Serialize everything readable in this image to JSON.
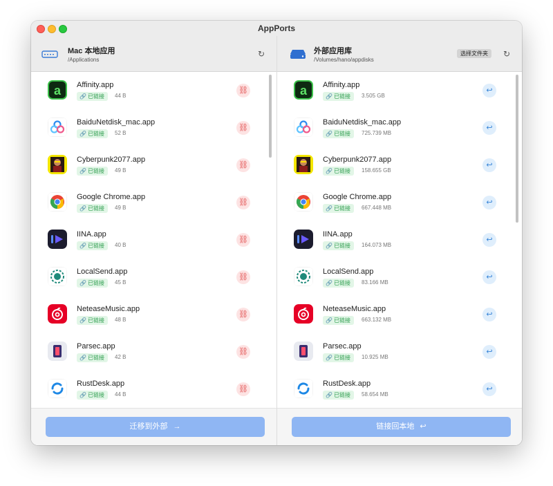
{
  "window": {
    "title": "AppPorts"
  },
  "left": {
    "title": "Mac 本地应用",
    "path": "/Applications",
    "refresh_icon": "refresh-icon",
    "action_icon": "unlink-icon",
    "footer_button": "迁移到外部",
    "footer_arrow": "→",
    "apps": [
      {
        "name": "Affinity.app",
        "status": "已链接",
        "size": "44 B",
        "icon": "affinity"
      },
      {
        "name": "BaiduNetdisk_mac.app",
        "status": "已链接",
        "size": "52 B",
        "icon": "baidu"
      },
      {
        "name": "Cyberpunk2077.app",
        "status": "已链接",
        "size": "49 B",
        "icon": "cyberpunk"
      },
      {
        "name": "Google Chrome.app",
        "status": "已链接",
        "size": "49 B",
        "icon": "chrome"
      },
      {
        "name": "IINA.app",
        "status": "已链接",
        "size": "40 B",
        "icon": "iina"
      },
      {
        "name": "LocalSend.app",
        "status": "已链接",
        "size": "45 B",
        "icon": "localsend"
      },
      {
        "name": "NeteaseMusic.app",
        "status": "已链接",
        "size": "48 B",
        "icon": "netease"
      },
      {
        "name": "Parsec.app",
        "status": "已链接",
        "size": "42 B",
        "icon": "parsec"
      },
      {
        "name": "RustDesk.app",
        "status": "已链接",
        "size": "44 B",
        "icon": "rustdesk"
      }
    ]
  },
  "right": {
    "title": "外部应用库",
    "path": "/Volumes/hano/appdisks",
    "choose_folder": "选择文件夹",
    "refresh_icon": "refresh-icon",
    "action_icon": "link-back-icon",
    "footer_button": "链接回本地",
    "footer_arrow": "↩",
    "apps": [
      {
        "name": "Affinity.app",
        "status": "已链接",
        "size": "3.505 GB",
        "icon": "affinity"
      },
      {
        "name": "BaiduNetdisk_mac.app",
        "status": "已链接",
        "size": "725.739 MB",
        "icon": "baidu"
      },
      {
        "name": "Cyberpunk2077.app",
        "status": "已链接",
        "size": "158.655 GB",
        "icon": "cyberpunk"
      },
      {
        "name": "Google Chrome.app",
        "status": "已链接",
        "size": "667.448 MB",
        "icon": "chrome"
      },
      {
        "name": "IINA.app",
        "status": "已链接",
        "size": "164.073 MB",
        "icon": "iina"
      },
      {
        "name": "LocalSend.app",
        "status": "已链接",
        "size": "83.166 MB",
        "icon": "localsend"
      },
      {
        "name": "NeteaseMusic.app",
        "status": "已链接",
        "size": "663.132 MB",
        "icon": "netease"
      },
      {
        "name": "Parsec.app",
        "status": "已链接",
        "size": "10.925 MB",
        "icon": "parsec"
      },
      {
        "name": "RustDesk.app",
        "status": "已链接",
        "size": "58.654 MB",
        "icon": "rustdesk"
      }
    ]
  },
  "colors": {
    "linked_badge_bg": "#e2f6e7",
    "linked_badge_text": "#2f9e4f",
    "unlink_button_bg": "#fde3e3",
    "unlink_button_fg": "#e04b4b",
    "linkback_button_bg": "#dfeefc",
    "linkback_button_fg": "#3a86d8",
    "primary_button": "#8fb6f3"
  }
}
